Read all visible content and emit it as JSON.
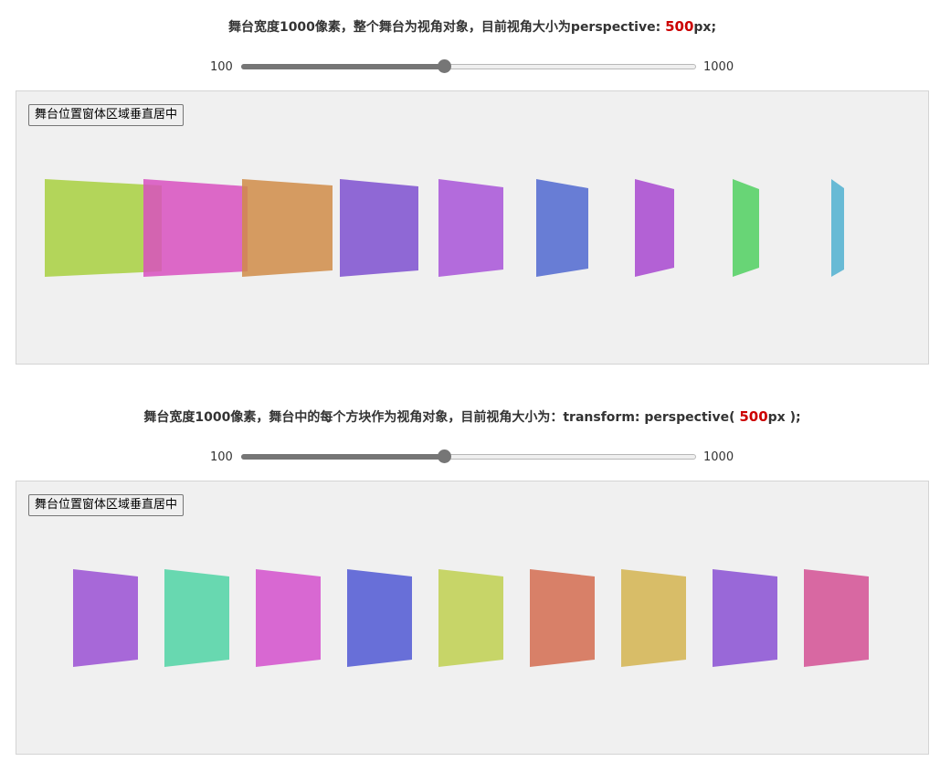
{
  "section1": {
    "title_prefix": "舞台宽度1000像素，整个舞台为视角对象，目前视角大小为perspective: ",
    "title_value": "500",
    "title_suffix": "px;",
    "slider": {
      "min_label": "100",
      "max_label": "1000",
      "min": 100,
      "max": 1000,
      "value": 500
    },
    "center_button": "舞台位置窗体区域垂直居中",
    "block_colors": [
      "#a8d040",
      "#d850c0",
      "#d08c48",
      "#7e50d0",
      "#a854d8",
      "#5068d0",
      "#a848d0",
      "#50d060",
      "#50b0d0"
    ]
  },
  "section2": {
    "title_prefix": "舞台宽度1000像素，舞台中的每个方块作为视角对象，目前视角大小为：transform: perspective( ",
    "title_value": "500",
    "title_suffix": "px );",
    "slider": {
      "min_label": "100",
      "max_label": "1000",
      "min": 100,
      "max": 1000,
      "value": 500
    },
    "center_button": "舞台位置窗体区域垂直居中",
    "block_colors": [
      "#9a50d4",
      "#50d4a4",
      "#d450cc",
      "#5058d4",
      "#c0d050",
      "#d46c50",
      "#d4b450",
      "#8a50d4",
      "#d45094"
    ]
  }
}
